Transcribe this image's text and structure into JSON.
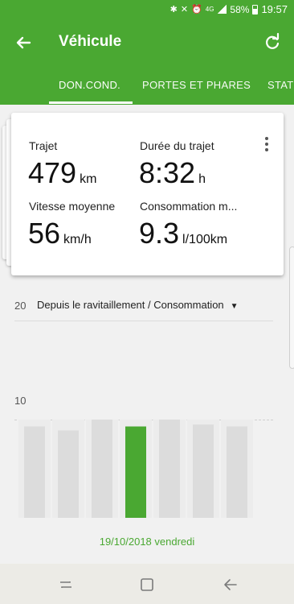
{
  "status": {
    "network": "4G",
    "battery": "58%",
    "time": "19:57",
    "icons": [
      "bluetooth-icon",
      "mute-icon",
      "alarm-icon",
      "signal-icon",
      "battery-icon"
    ]
  },
  "appbar": {
    "title": "Véhicule",
    "color": "#4aa832"
  },
  "tabs": [
    {
      "label": "DON.COND.",
      "active": true
    },
    {
      "label": "PORTES ET PHARES",
      "active": false
    },
    {
      "label": "STAT",
      "active": false
    }
  ],
  "card": {
    "stats": [
      {
        "label": "Trajet",
        "value": "479",
        "unit": "km"
      },
      {
        "label": "Durée du trajet",
        "value": "8:32",
        "unit": "h"
      },
      {
        "label": "Vitesse moyenne",
        "value": "56",
        "unit": "km/h"
      },
      {
        "label": "Consommation m...",
        "value": "9.3",
        "unit": "l/100km"
      }
    ]
  },
  "chart": {
    "dropdown_label": "Depuis le ravitaillement / Consommation",
    "date_label": "19/10/2018 vendredi"
  },
  "chart_data": {
    "type": "bar",
    "y_ticks": [
      "20",
      "10"
    ],
    "values": [
      9.3,
      8.9,
      10.0,
      9.3,
      10.0,
      9.5,
      9.3
    ],
    "highlight_index": 3,
    "highlight_color": "#4aa832",
    "bar_color": "#dcdcdc",
    "ylim": [
      0,
      20
    ]
  }
}
